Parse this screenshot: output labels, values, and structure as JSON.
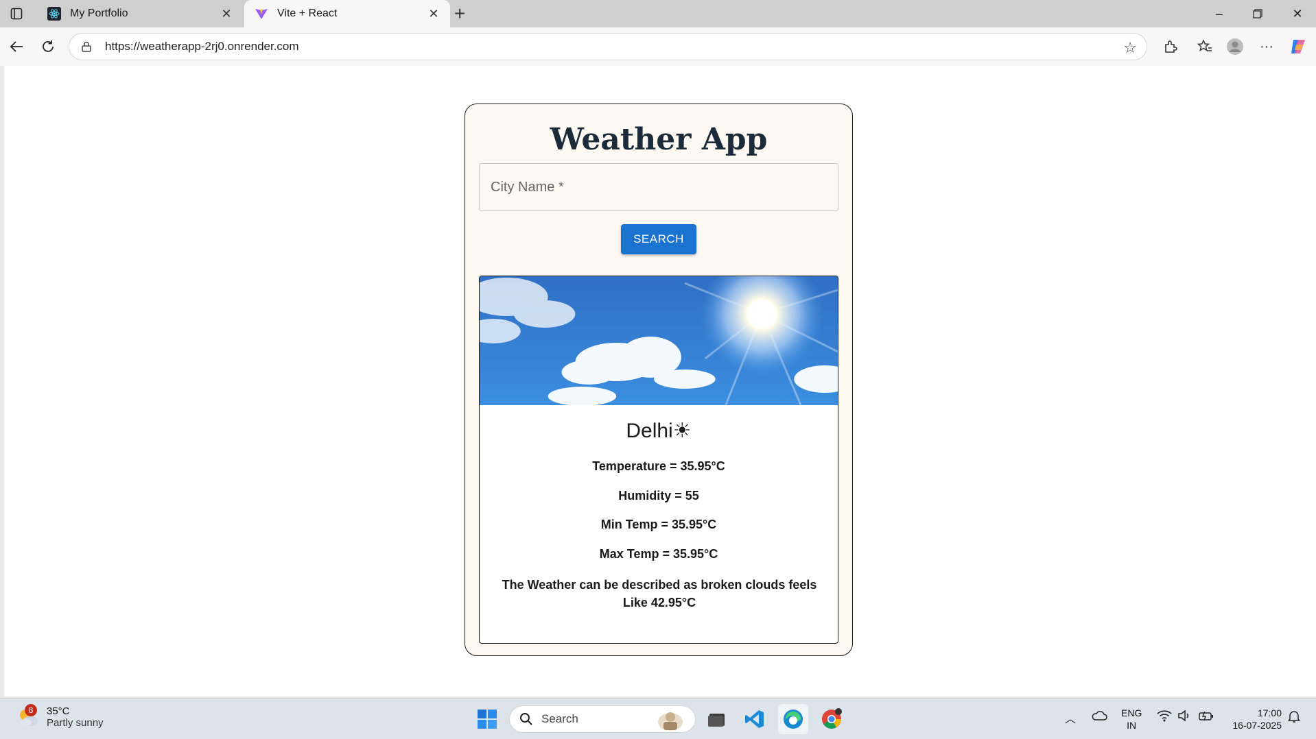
{
  "browser": {
    "tabs": [
      {
        "label": "My Portfolio",
        "active": false
      },
      {
        "label": "Vite + React",
        "active": true
      }
    ],
    "url": "https://weatherapp-2rj0.onrender.com"
  },
  "app": {
    "title": "Weather App",
    "city_placeholder": "City Name *",
    "search_label": "SEARCH",
    "result": {
      "city": "Delhi",
      "condition_emoji": "☀",
      "temperature": "Temperature = 35.95°C",
      "humidity": "Humidity = 55",
      "min_temp": "Min Temp = 35.95°C",
      "max_temp": "Max Temp = 35.95°C",
      "description": "The Weather can be described as broken clouds feels Like 42.95°C"
    }
  },
  "taskbar": {
    "weather_temp": "35°C",
    "weather_desc": "Partly sunny",
    "weather_badge": "8",
    "search_label": "Search",
    "lang_line1": "ENG",
    "lang_line2": "IN",
    "time": "17:00",
    "date": "16-07-2025"
  },
  "colors": {
    "accent": "#1a73d1",
    "card_bg": "#fdf8f1",
    "title": "#1c2b3a"
  }
}
